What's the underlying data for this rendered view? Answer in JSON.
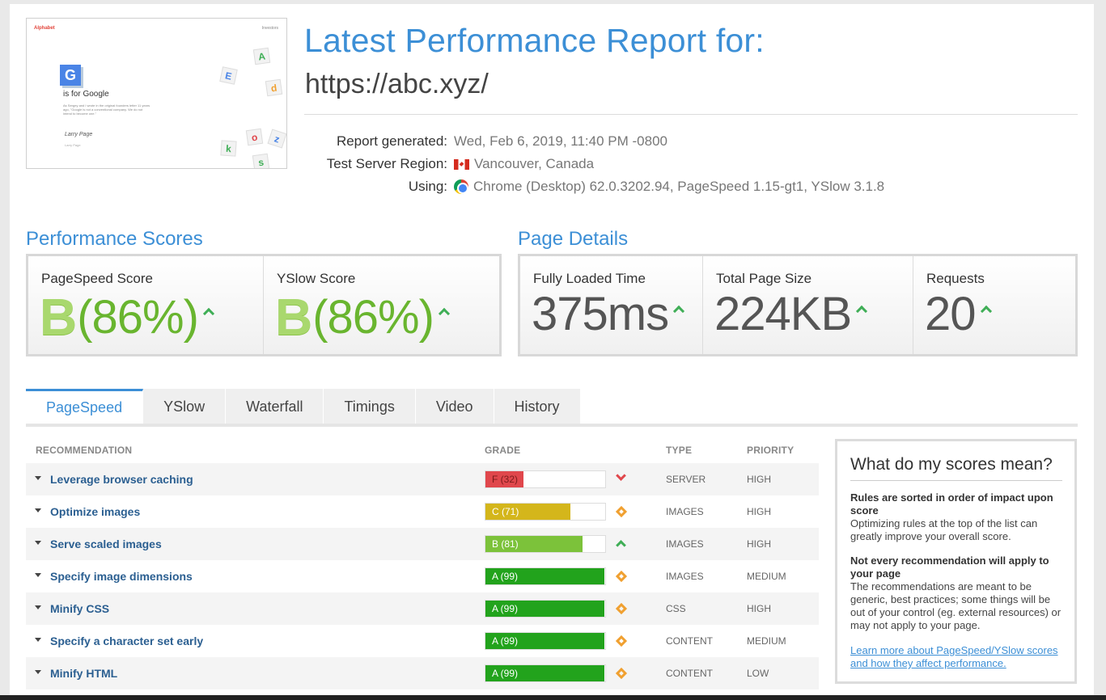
{
  "report": {
    "title": "Latest Performance Report for:",
    "url": "https://abc.xyz/",
    "meta": [
      {
        "label": "Report generated:",
        "value": "Wed, Feb 6, 2019, 11:40 PM -0800",
        "icon": ""
      },
      {
        "label": "Test Server Region:",
        "value": "Vancouver, Canada",
        "icon": "canada-flag-icon"
      },
      {
        "label": "Using:",
        "value": "Chrome (Desktop) 62.0.3202.94, PageSpeed 1.15-gt1, YSlow 3.1.8",
        "icon": "chrome-icon"
      }
    ]
  },
  "thumbnail": {
    "brand": "Alphabet",
    "nav": "Investors",
    "headline": "is for Google",
    "g_letter": "G",
    "body": "As Sergey and I wrote in the original founders letter 11 years ago, \"Google is not a conventional company. We do not intend to become one.\"",
    "signature": "Larry Page",
    "sign_caption": "Larry Page",
    "blocks": [
      "A",
      "E",
      "d",
      "k",
      "o",
      "z",
      "s"
    ]
  },
  "performance": {
    "title": "Performance Scores",
    "pagespeed": {
      "label": "PageSpeed Score",
      "grade": "B",
      "pct": "(86%)"
    },
    "yslow": {
      "label": "YSlow Score",
      "grade": "B",
      "pct": "(86%)"
    }
  },
  "details": {
    "title": "Page Details",
    "loaded": {
      "label": "Fully Loaded Time",
      "value": "375ms"
    },
    "size": {
      "label": "Total Page Size",
      "value": "224KB"
    },
    "requests": {
      "label": "Requests",
      "value": "20"
    }
  },
  "tabs": [
    "PageSpeed",
    "YSlow",
    "Waterfall",
    "Timings",
    "Video",
    "History"
  ],
  "table": {
    "headers": {
      "recommendation": "RECOMMENDATION",
      "grade": "GRADE",
      "type": "TYPE",
      "priority": "PRIORITY"
    },
    "rows": [
      {
        "name": "Leverage browser caching",
        "grade": "F (32)",
        "score": 0.32,
        "color": "#e0474c",
        "text_color": "#7a1c1c",
        "status": "red-chevron-down-icon",
        "type": "SERVER",
        "priority": "HIGH"
      },
      {
        "name": "Optimize images",
        "grade": "C (71)",
        "score": 0.71,
        "color": "#d4b61b",
        "text_color": "#ffffff",
        "status": "orange-diamond-icon",
        "type": "IMAGES",
        "priority": "HIGH"
      },
      {
        "name": "Serve scaled images",
        "grade": "B (81)",
        "score": 0.81,
        "color": "#7cc23a",
        "text_color": "#ffffff",
        "status": "green-chevron-up-icon",
        "type": "IMAGES",
        "priority": "HIGH"
      },
      {
        "name": "Specify image dimensions",
        "grade": "A (99)",
        "score": 0.99,
        "color": "#22a31c",
        "text_color": "#ffffff",
        "status": "orange-diamond-icon",
        "type": "IMAGES",
        "priority": "MEDIUM"
      },
      {
        "name": "Minify CSS",
        "grade": "A (99)",
        "score": 0.99,
        "color": "#22a31c",
        "text_color": "#ffffff",
        "status": "orange-diamond-icon",
        "type": "CSS",
        "priority": "HIGH"
      },
      {
        "name": "Specify a character set early",
        "grade": "A (99)",
        "score": 0.99,
        "color": "#22a31c",
        "text_color": "#ffffff",
        "status": "orange-diamond-icon",
        "type": "CONTENT",
        "priority": "MEDIUM"
      },
      {
        "name": "Minify HTML",
        "grade": "A (99)",
        "score": 0.99,
        "color": "#22a31c",
        "text_color": "#ffffff",
        "status": "orange-diamond-icon",
        "type": "CONTENT",
        "priority": "LOW"
      }
    ]
  },
  "sidebar": {
    "title": "What do my scores mean?",
    "h1": "Rules are sorted in order of impact upon score",
    "p1": "Optimizing rules at the top of the list can greatly improve your overall score.",
    "h2": "Not every recommendation will apply to your page",
    "p2": "The recommendations are meant to be generic, best practices; some things will be out of your control (eg. external resources) or may not apply to your page.",
    "link": "Learn more about PageSpeed/YSlow scores and how they affect performance."
  }
}
